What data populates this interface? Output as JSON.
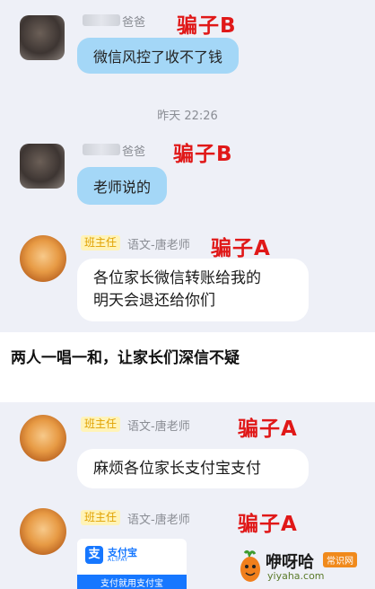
{
  "panel1": {
    "msg1": {
      "name_suffix": "爸爸",
      "label": "骗子B",
      "text": "微信风控了收不了钱"
    },
    "timestamp": "昨天 22:26",
    "msg2": {
      "name_suffix": "爸爸",
      "label": "骗子B",
      "text": "老师说的"
    },
    "msg3": {
      "badge": "班主任",
      "role": "语文-唐老师",
      "label": "骗子A",
      "line1": "各位家长微信转账给我的",
      "line2": "明天会退还给你们"
    }
  },
  "caption": "两人一唱一和，让家长们深信不疑",
  "panel2": {
    "msg4": {
      "badge": "班主任",
      "role": "语文-唐老师",
      "label": "骗子A",
      "text": "麻烦各位家长支付宝支付"
    },
    "msg5": {
      "badge": "班主任",
      "role": "语文-唐老师",
      "label": "骗子A",
      "card": {
        "logo": "支",
        "name": "支付宝",
        "sub": "ALIPAY",
        "bar": "支付就用支付宝"
      }
    }
  },
  "watermark": {
    "name": "咿呀哈",
    "badge": "常识网",
    "url": "yiyaha.com"
  },
  "colors": {
    "scam_label": "#e01818",
    "bubble_blue": "#a4d7f7",
    "badge_bg": "#fff3b8",
    "alipay": "#1677ff"
  }
}
